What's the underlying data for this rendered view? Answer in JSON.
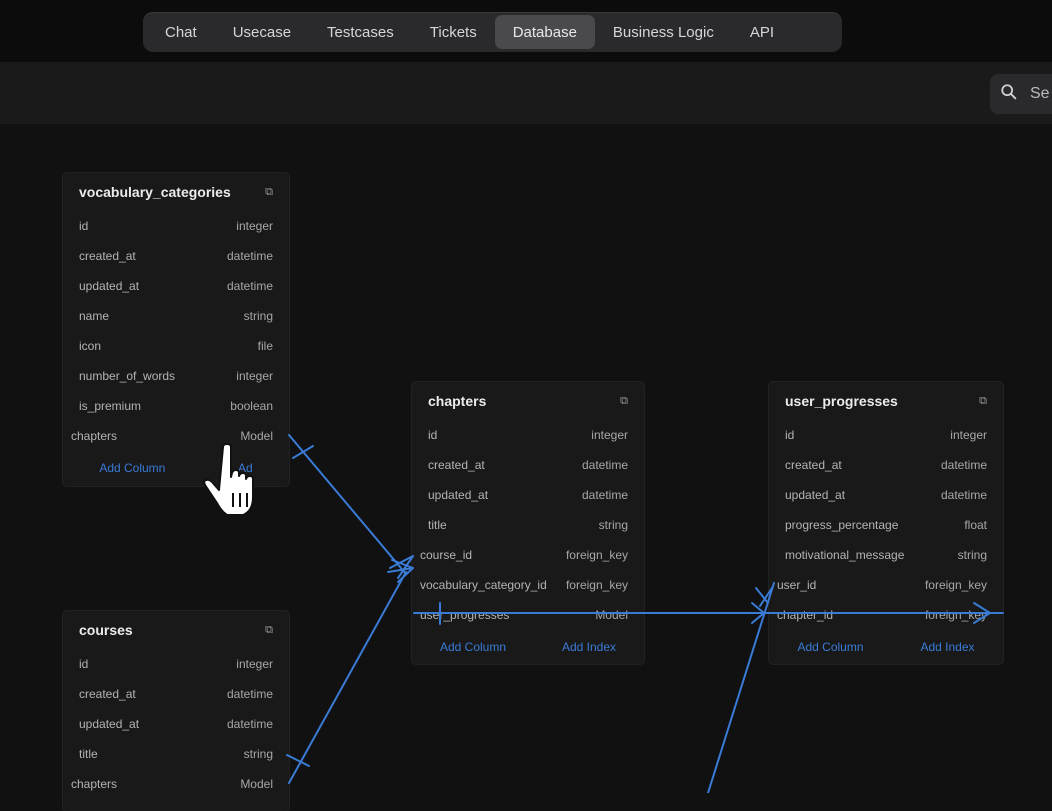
{
  "nav": {
    "tabs": [
      {
        "label": "Chat"
      },
      {
        "label": "Usecase"
      },
      {
        "label": "Testcases"
      },
      {
        "label": "Tickets"
      },
      {
        "label": "Database",
        "active": true
      },
      {
        "label": "Business Logic"
      },
      {
        "label": "API"
      }
    ]
  },
  "search": {
    "placeholder": "Se"
  },
  "colors": {
    "accent": "#3a7bd5",
    "background": "#111112",
    "card": "#19191a"
  },
  "tables": {
    "vocabulary_categories": {
      "name": "vocabulary_categories",
      "rows": [
        {
          "field": "id",
          "type": "integer"
        },
        {
          "field": "created_at",
          "type": "datetime"
        },
        {
          "field": "updated_at",
          "type": "datetime"
        },
        {
          "field": "name",
          "type": "string"
        },
        {
          "field": "icon",
          "type": "file"
        },
        {
          "field": "number_of_words",
          "type": "integer"
        },
        {
          "field": "is_premium",
          "type": "boolean"
        },
        {
          "field": "chapters",
          "type": "Model"
        }
      ],
      "add_column": "Add Column",
      "add_index": "Ad"
    },
    "chapters": {
      "name": "chapters",
      "rows": [
        {
          "field": "id",
          "type": "integer"
        },
        {
          "field": "created_at",
          "type": "datetime"
        },
        {
          "field": "updated_at",
          "type": "datetime"
        },
        {
          "field": "title",
          "type": "string"
        },
        {
          "field": "course_id",
          "type": "foreign_key"
        },
        {
          "field": "vocabulary_category_id",
          "type": "foreign_key"
        },
        {
          "field": "user_progresses",
          "type": "Model"
        }
      ],
      "add_column": "Add Column",
      "add_index": "Add Index"
    },
    "user_progresses": {
      "name": "user_progresses",
      "rows": [
        {
          "field": "id",
          "type": "integer"
        },
        {
          "field": "created_at",
          "type": "datetime"
        },
        {
          "field": "updated_at",
          "type": "datetime"
        },
        {
          "field": "progress_percentage",
          "type": "float"
        },
        {
          "field": "motivational_message",
          "type": "string"
        },
        {
          "field": "user_id",
          "type": "foreign_key"
        },
        {
          "field": "chapter_id",
          "type": "foreign_key"
        }
      ],
      "add_column": "Add Column",
      "add_index": "Add Index"
    },
    "courses": {
      "name": "courses",
      "rows": [
        {
          "field": "id",
          "type": "integer"
        },
        {
          "field": "created_at",
          "type": "datetime"
        },
        {
          "field": "updated_at",
          "type": "datetime"
        },
        {
          "field": "title",
          "type": "string"
        },
        {
          "field": "chapters",
          "type": "Model"
        }
      ]
    }
  }
}
